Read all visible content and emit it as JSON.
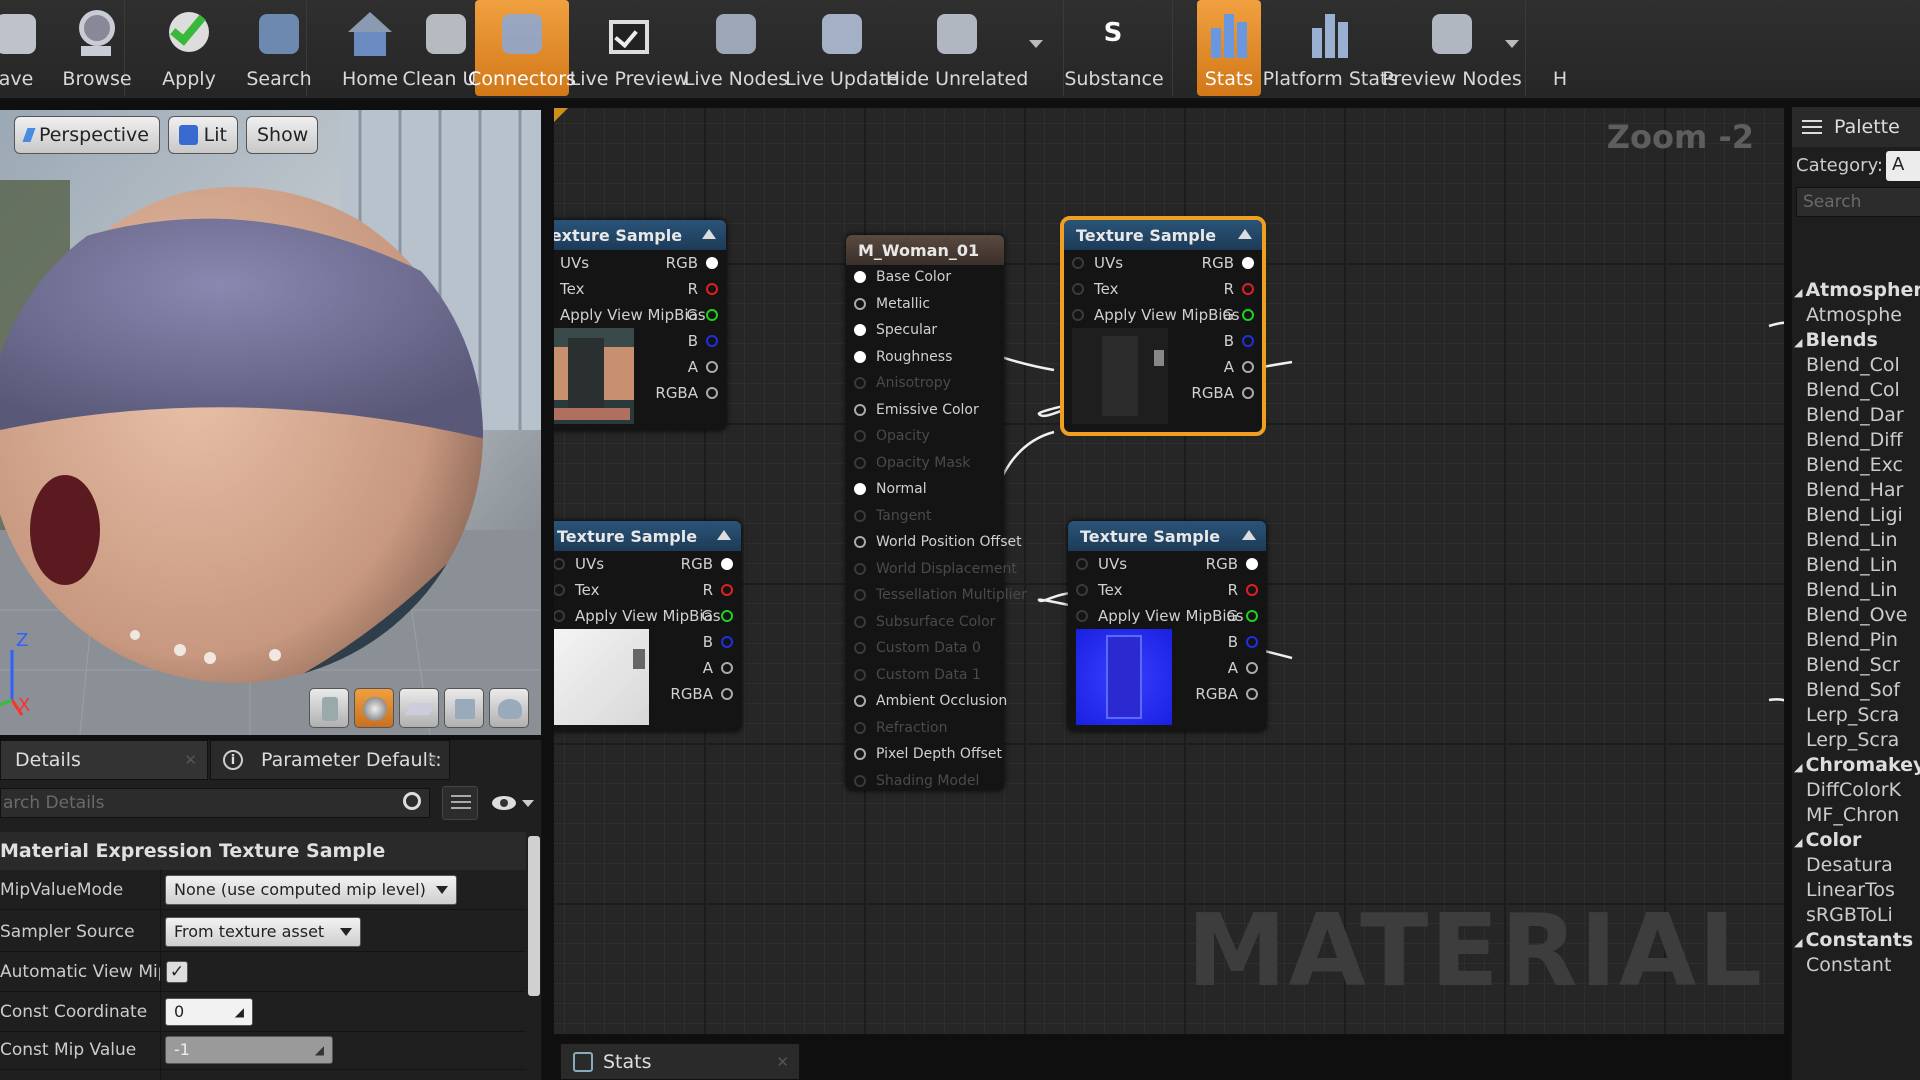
{
  "toolbar": {
    "buttons": [
      {
        "label": "ave",
        "icon": "save-icon"
      },
      {
        "label": "Browse",
        "icon": "browse-icon"
      },
      {
        "label": "Apply",
        "icon": "apply-check-icon"
      },
      {
        "label": "Search",
        "icon": "search-binoculars-icon"
      },
      {
        "label": "Home",
        "icon": "home-icon"
      },
      {
        "label": "Clean Up",
        "icon": "clean-up-icon"
      },
      {
        "label": "Connectors",
        "icon": "connectors-icon"
      },
      {
        "label": "Live Preview",
        "icon": "live-preview-icon"
      },
      {
        "label": "Live Nodes",
        "icon": "live-nodes-icon"
      },
      {
        "label": "Live Update",
        "icon": "live-update-icon"
      },
      {
        "label": "Hide Unrelated",
        "icon": "hide-unrelated-icon"
      },
      {
        "label": "Substance",
        "icon": "substance-icon"
      },
      {
        "label": "Stats",
        "icon": "stats-icon"
      },
      {
        "label": "Platform Stats",
        "icon": "platform-stats-icon"
      },
      {
        "label": "Preview Nodes",
        "icon": "preview-nodes-icon"
      },
      {
        "label": "H",
        "icon": "more-icon"
      }
    ],
    "active": [
      "Connectors",
      "Stats"
    ]
  },
  "viewport": {
    "perspective": "Perspective",
    "lit": "Lit",
    "show": "Show",
    "axis_z": "Z",
    "axis_x": "X"
  },
  "details": {
    "tab1": "Details",
    "tab2": "Parameter Default:",
    "search_placeholder": "arch Details",
    "section": "Material Expression Texture Sample",
    "rows": [
      {
        "label": "MipValueMode",
        "value": "None (use computed mip level)"
      },
      {
        "label": "Sampler Source",
        "value": "From texture asset"
      },
      {
        "label": "Automatic View Mip",
        "value": "checked"
      },
      {
        "label": "Const Coordinate",
        "value": "0"
      },
      {
        "label": "Const Mip Value",
        "value": "-1"
      }
    ]
  },
  "graph": {
    "zoom": "Zoom -2",
    "watermark": "MATERIAL",
    "texture_node_title": "Texture Sample",
    "tex_inputs": [
      "UVs",
      "Tex",
      "Apply View MipBias"
    ],
    "tex_outputs": [
      "RGB",
      "R",
      "G",
      "B",
      "A",
      "RGBA"
    ],
    "material": {
      "title": "M_Woman_01",
      "pins": [
        {
          "label": "Base Color",
          "active": true
        },
        {
          "label": "Metallic",
          "active": true
        },
        {
          "label": "Specular",
          "active": true
        },
        {
          "label": "Roughness",
          "active": true
        },
        {
          "label": "Anisotropy",
          "active": false
        },
        {
          "label": "Emissive Color",
          "active": true
        },
        {
          "label": "Opacity",
          "active": false
        },
        {
          "label": "Opacity Mask",
          "active": false
        },
        {
          "label": "Normal",
          "active": true
        },
        {
          "label": "Tangent",
          "active": false
        },
        {
          "label": "World Position Offset",
          "active": true
        },
        {
          "label": "World Displacement",
          "active": false
        },
        {
          "label": "Tessellation Multiplier",
          "active": false
        },
        {
          "label": "Subsurface Color",
          "active": false
        },
        {
          "label": "Custom Data 0",
          "active": false
        },
        {
          "label": "Custom Data 1",
          "active": false
        },
        {
          "label": "Ambient Occlusion",
          "active": true
        },
        {
          "label": "Refraction",
          "active": false
        },
        {
          "label": "Pixel Depth Offset",
          "active": true
        },
        {
          "label": "Shading Model",
          "active": false
        }
      ]
    }
  },
  "palette": {
    "title": "Palette",
    "category_label": "Category:",
    "category_value": "A",
    "search_placeholder": "Search",
    "items": [
      {
        "label": "Atmospher",
        "cat": true
      },
      {
        "label": "Atmosphe",
        "cat": false
      },
      {
        "label": "Blends",
        "cat": true
      },
      {
        "label": "Blend_Col",
        "cat": false
      },
      {
        "label": "Blend_Col",
        "cat": false
      },
      {
        "label": "Blend_Dar",
        "cat": false
      },
      {
        "label": "Blend_Diff",
        "cat": false
      },
      {
        "label": "Blend_Exc",
        "cat": false
      },
      {
        "label": "Blend_Har",
        "cat": false
      },
      {
        "label": "Blend_Ligi",
        "cat": false
      },
      {
        "label": "Blend_Lin",
        "cat": false
      },
      {
        "label": "Blend_Lin",
        "cat": false
      },
      {
        "label": "Blend_Lin",
        "cat": false
      },
      {
        "label": "Blend_Ove",
        "cat": false
      },
      {
        "label": "Blend_Pin",
        "cat": false
      },
      {
        "label": "Blend_Scr",
        "cat": false
      },
      {
        "label": "Blend_Sof",
        "cat": false
      },
      {
        "label": "Lerp_Scra",
        "cat": false
      },
      {
        "label": "Lerp_Scra",
        "cat": false
      },
      {
        "label": "Chromakey",
        "cat": true
      },
      {
        "label": "DiffColorK",
        "cat": false
      },
      {
        "label": "MF_Chron",
        "cat": false
      },
      {
        "label": "Color",
        "cat": true
      },
      {
        "label": "Desatura",
        "cat": false
      },
      {
        "label": "LinearTos",
        "cat": false
      },
      {
        "label": "sRGBToLi",
        "cat": false
      },
      {
        "label": "Constants",
        "cat": true
      },
      {
        "label": "Constant",
        "cat": false
      }
    ]
  },
  "stats_tab": "Stats",
  "colors": {
    "accent": "#e08a28",
    "node_header": "#24476a",
    "selected_outline": "#f0a020"
  }
}
